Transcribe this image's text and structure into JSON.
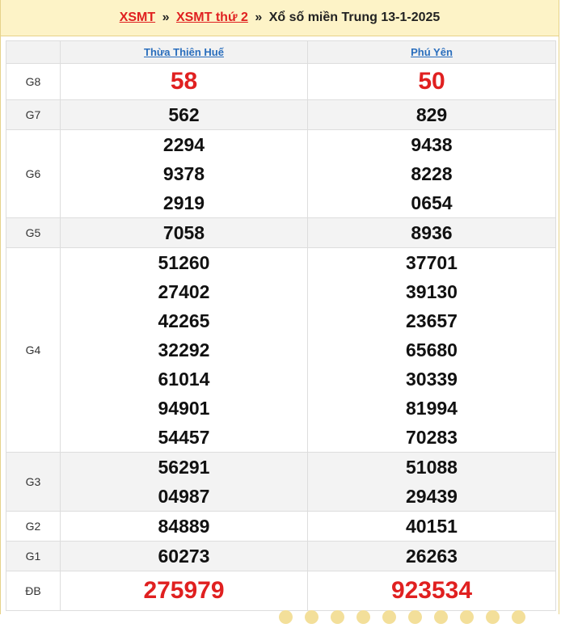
{
  "header": {
    "link1": "XSMT",
    "sep1": "»",
    "link2": "XSMT thứ 2",
    "sep2": "»",
    "title": "Xổ số miền Trung 13-1-2025"
  },
  "provinces": [
    "Thừa Thiên Huế",
    "Phú Yên"
  ],
  "prizes": {
    "g8": {
      "label": "G8",
      "col1": [
        "58"
      ],
      "col2": [
        "50"
      ]
    },
    "g7": {
      "label": "G7",
      "col1": [
        "562"
      ],
      "col2": [
        "829"
      ]
    },
    "g6": {
      "label": "G6",
      "col1": [
        "2294",
        "9378",
        "2919"
      ],
      "col2": [
        "9438",
        "8228",
        "0654"
      ]
    },
    "g5": {
      "label": "G5",
      "col1": [
        "7058"
      ],
      "col2": [
        "8936"
      ]
    },
    "g4": {
      "label": "G4",
      "col1": [
        "51260",
        "27402",
        "42265",
        "32292",
        "61014",
        "94901",
        "54457"
      ],
      "col2": [
        "37701",
        "39130",
        "23657",
        "65680",
        "30339",
        "81994",
        "70283"
      ]
    },
    "g3": {
      "label": "G3",
      "col1": [
        "56291",
        "04987"
      ],
      "col2": [
        "51088",
        "29439"
      ]
    },
    "g2": {
      "label": "G2",
      "col1": [
        "84889"
      ],
      "col2": [
        "40151"
      ]
    },
    "g1": {
      "label": "G1",
      "col1": [
        "60273"
      ],
      "col2": [
        "26263"
      ]
    },
    "db": {
      "label": "ĐB",
      "col1": [
        "275979"
      ],
      "col2": [
        "923534"
      ]
    }
  },
  "colors": {
    "accent_red": "#e02020",
    "link_blue": "#2a6ebd",
    "header_bg": "#fdf3c7"
  }
}
